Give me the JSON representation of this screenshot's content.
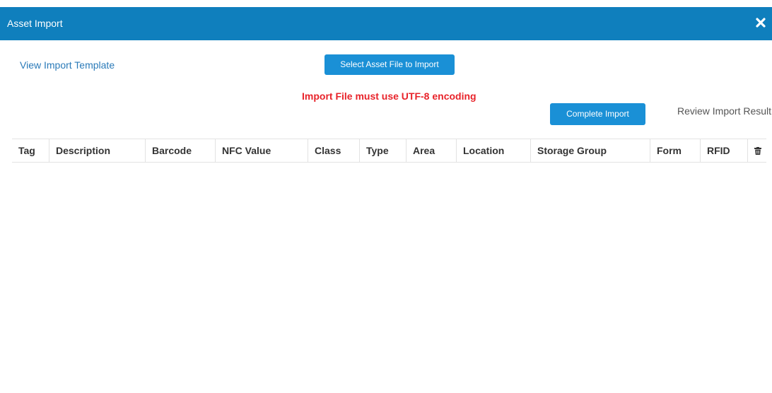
{
  "dialog": {
    "title": "Asset Import",
    "close_icon": "close-icon"
  },
  "toolbar": {
    "template_link": "View Import Template",
    "select_file_label": "Select Asset File to Import",
    "encoding_warning": "Import File must use UTF-8 encoding",
    "complete_label": "Complete Import",
    "review_label": "Review Import Result"
  },
  "table": {
    "columns": [
      "Tag",
      "Description",
      "Barcode",
      "NFC Value",
      "Class",
      "Type",
      "Area",
      "Location",
      "Storage Group",
      "Form",
      "RFID"
    ],
    "delete_icon": "trash-icon",
    "rows": []
  },
  "colors": {
    "header_bg": "#0f7fbd",
    "button_bg": "#1a90d6",
    "warning": "#e8232a",
    "link": "#2a7ab8"
  }
}
